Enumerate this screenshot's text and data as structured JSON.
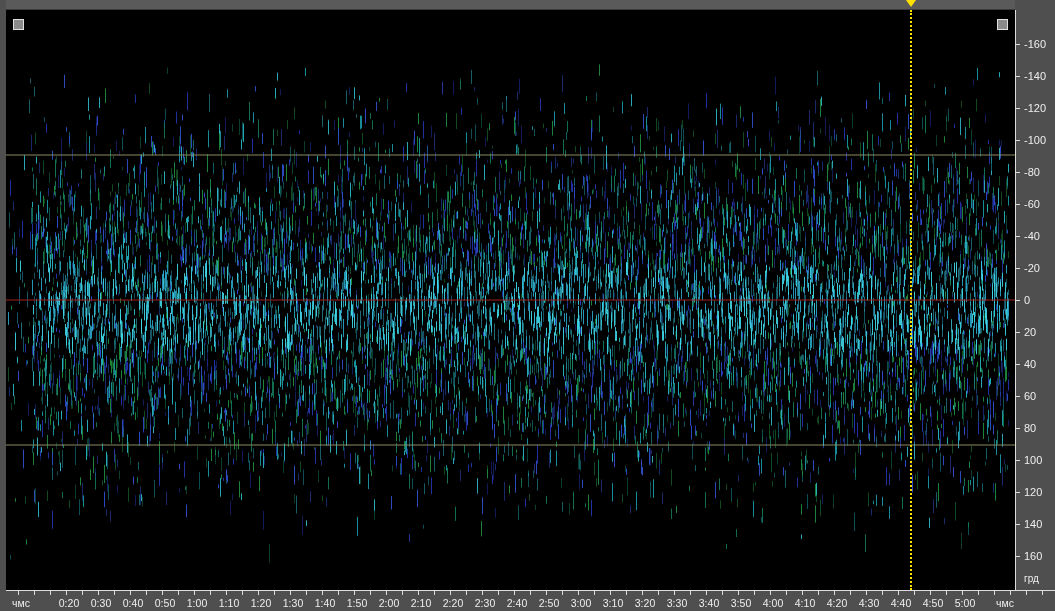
{
  "phase_display": {
    "y_axis": {
      "labels": [
        "-160",
        "-140",
        "-120",
        "-100",
        "-80",
        "-60",
        "-40",
        "-20",
        "0",
        "20",
        "40",
        "60",
        "80",
        "100",
        "120",
        "140",
        "160"
      ],
      "unit": "грд"
    },
    "x_axis": {
      "unit_left": "чмс",
      "labels": [
        "0:20",
        "0:30",
        "0:40",
        "0:50",
        "1:00",
        "1:10",
        "1:20",
        "1:30",
        "1:40",
        "1:50",
        "2:00",
        "2:10",
        "2:20",
        "2:30",
        "2:40",
        "2:50",
        "3:00",
        "3:10",
        "3:20",
        "3:30",
        "3:40",
        "3:50",
        "4:00",
        "4:10",
        "4:20",
        "4:30",
        "4:40",
        "4:50",
        "5:00"
      ],
      "unit_right": "чмс"
    },
    "cursor": {
      "level": 0.897
    }
  }
}
